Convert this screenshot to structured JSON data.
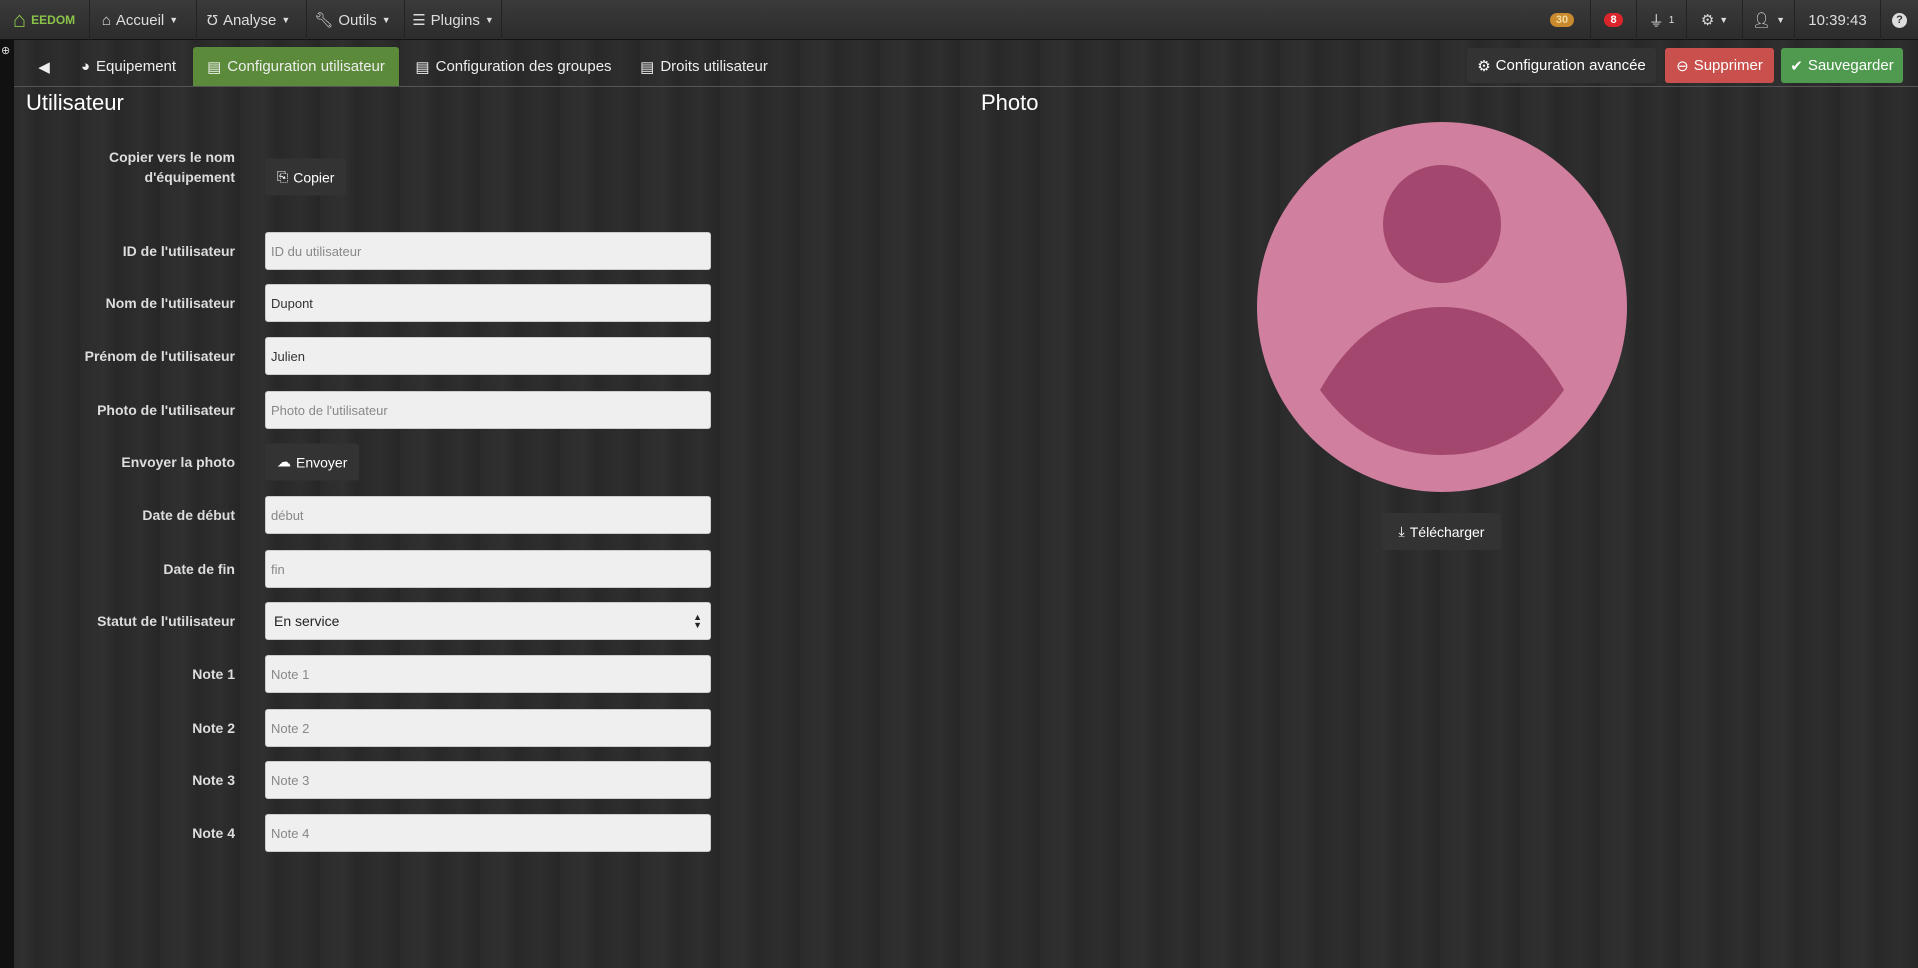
{
  "nav": {
    "logo": "EEDOM",
    "items": [
      {
        "label": "Accueil",
        "icon": "home-icon"
      },
      {
        "label": "Analyse",
        "icon": "stethoscope-icon"
      },
      {
        "label": "Outils",
        "icon": "wrench-icon"
      },
      {
        "label": "Plugins",
        "icon": "list-icon"
      }
    ],
    "badge_orange": "30",
    "badge_red": "8",
    "plug_count": "1",
    "time": "10:39:43"
  },
  "tabs": {
    "equipement": "Equipement",
    "config_user": "Configuration utilisateur",
    "config_groups": "Configuration des groupes",
    "rights": "Droits utilisateur"
  },
  "actions": {
    "advanced": "Configuration avancée",
    "delete": "Supprimer",
    "save": "Sauvegarder"
  },
  "colors": {
    "active_tab": "#5a8a3a",
    "delete": "#c9504c",
    "save": "#4f9a4f",
    "avatar_bg": "#d17f9f",
    "avatar_fg": "#a3476f"
  },
  "form": {
    "title": "Utilisateur",
    "copy_label": "Copier vers le nom d'équipement",
    "copy_btn": "Copier",
    "id_label": "ID de l'utilisateur",
    "id_placeholder": "ID du utilisateur",
    "name_label": "Nom de l'utilisateur",
    "name_value": "Dupont",
    "firstname_label": "Prénom de l'utilisateur",
    "firstname_value": "Julien",
    "photo_label": "Photo de l'utilisateur",
    "photo_placeholder": "Photo de l'utilisateur",
    "upload_label": "Envoyer la photo",
    "upload_btn": "Envoyer",
    "start_label": "Date de début",
    "start_placeholder": "début",
    "end_label": "Date de fin",
    "end_placeholder": "fin",
    "status_label": "Statut de l'utilisateur",
    "status_value": "En service",
    "note1_label": "Note 1",
    "note1_placeholder": "Note 1",
    "note2_label": "Note 2",
    "note2_placeholder": "Note 2",
    "note3_label": "Note 3",
    "note3_placeholder": "Note 3",
    "note4_label": "Note 4",
    "note4_placeholder": "Note 4"
  },
  "photo": {
    "title": "Photo",
    "download_btn": "Télécharger"
  }
}
